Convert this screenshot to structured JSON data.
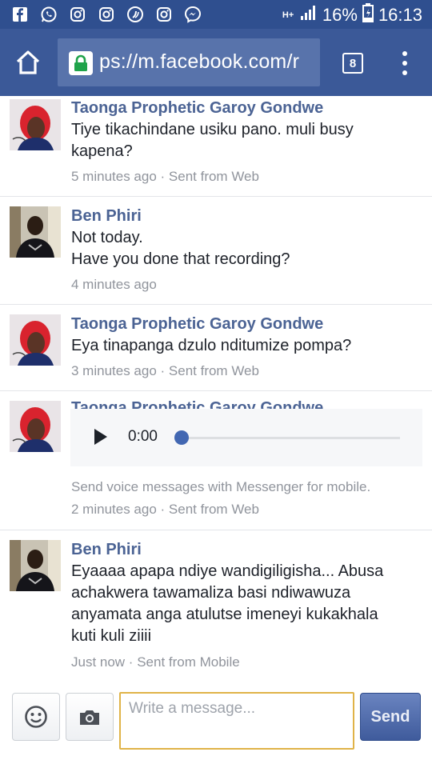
{
  "status_bar": {
    "app_icons": [
      "facebook-icon",
      "whatsapp-icon",
      "instagram-icon",
      "instagram-icon",
      "opera-icon",
      "instagram-icon",
      "messenger-icon"
    ],
    "network": "H+",
    "battery": "16%",
    "time": "16:13"
  },
  "browser": {
    "url": "ps://m.facebook.com/r",
    "tab_count": "8"
  },
  "messages": [
    {
      "sender": "Taonga Prophetic Garoy Gondwe",
      "lines": [
        "Tiye tikachindane usiku pano. muli busy",
        "kapena?"
      ],
      "meta": "5 minutes ago · Sent from Web"
    },
    {
      "sender": "Ben Phiri",
      "lines": [
        "Not today.",
        "Have you done that recording?"
      ],
      "meta": "4 minutes ago"
    },
    {
      "sender": "Taonga Prophetic Garoy Gondwe",
      "lines": [
        "Eya tinapanga dzulo nditumize pompa?"
      ],
      "meta": "3 minutes ago · Sent from Web"
    },
    {
      "sender": "Taonga Prophetic Garoy Gondwe",
      "audio_time": "0:00",
      "audio_progress": 0,
      "note": "Send voice messages with Messenger for mobile.",
      "meta": "2 minutes ago · Sent from Web"
    },
    {
      "sender": "Ben Phiri",
      "lines": [
        "Eyaaaa apapa ndiye wandigiligisha... Abusa",
        "achakwera tawamaliza basi ndiwawuza",
        "anyamata anga atulutse imeneyi kukakhala",
        "kuti kuli ziiii"
      ],
      "meta": "Just now · Sent from Mobile"
    }
  ],
  "composer": {
    "placeholder": "Write a message...",
    "send_label": "Send"
  },
  "colors": {
    "status_bar": "#2f4f8f",
    "toolbar": "#3b5998",
    "sender_name": "#4b6394",
    "input_border": "#e0b348"
  }
}
